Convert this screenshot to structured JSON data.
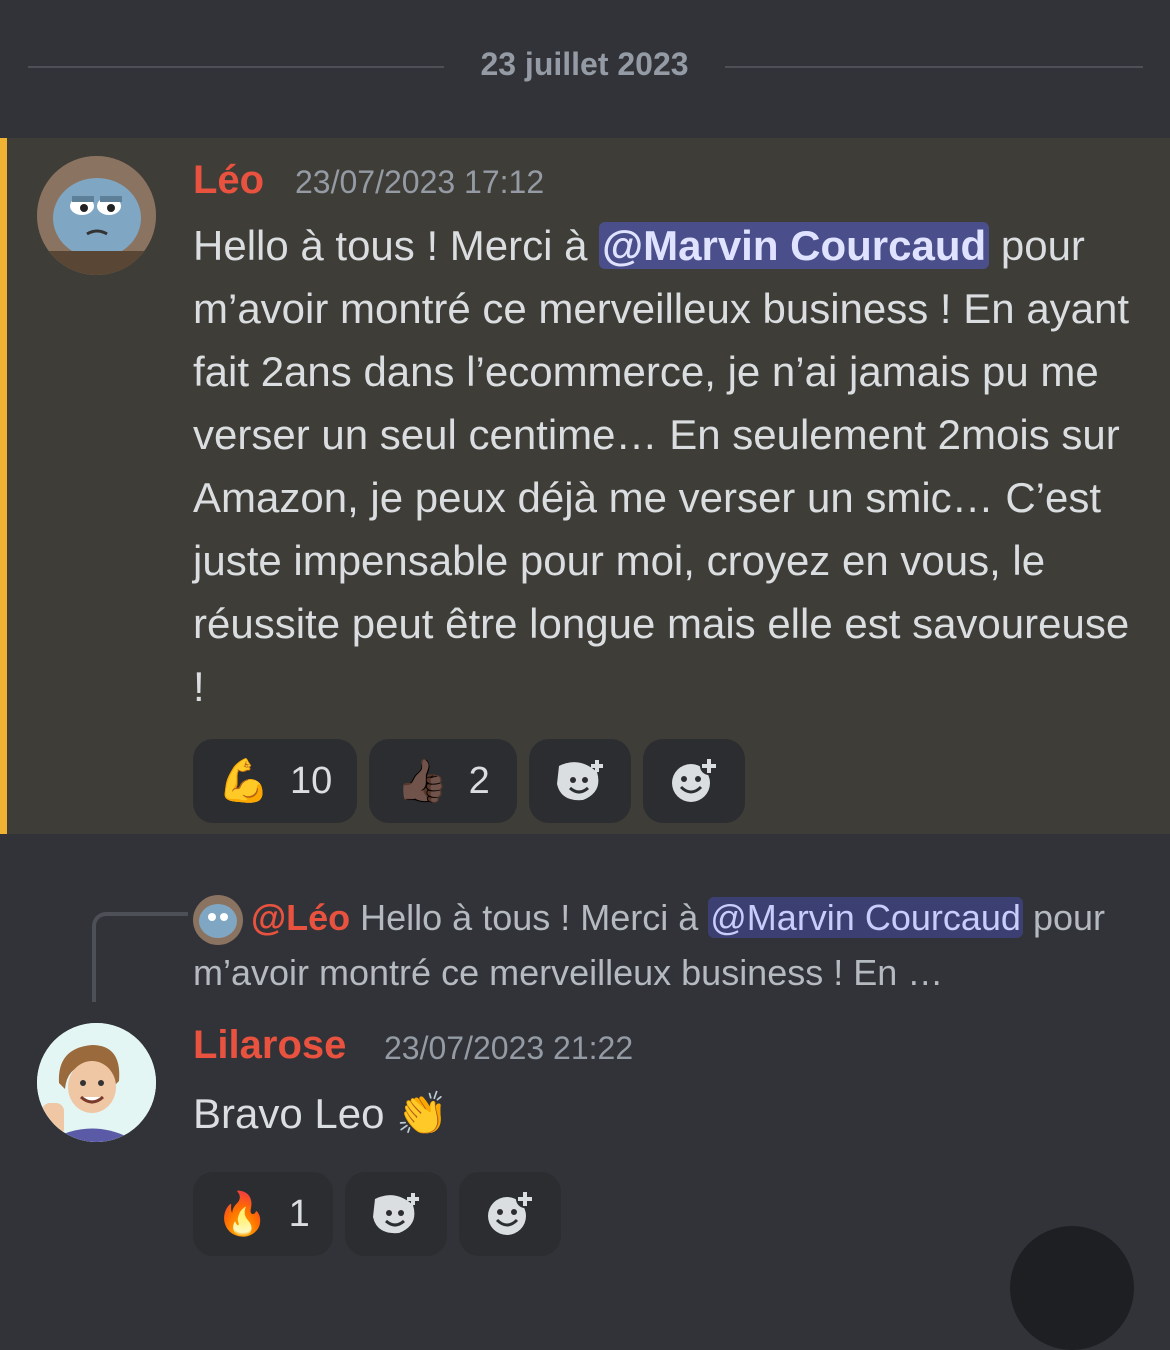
{
  "date_divider": "23 juillet 2023",
  "message1": {
    "author": "Léo",
    "timestamp": "23/07/2023 17:12",
    "text_before": "Hello à tous ! Merci à ",
    "mention": "@Marvin Courcaud",
    "text_after": " pour m’avoir montré ce merveilleux business ! En ayant fait 2ans dans l’ecommerce, je n’ai jamais pu me verser un seul centime… En seulement 2mois sur Amazon, je peux déjà me verser un smic… C’est juste impensable pour moi, croyez en vous, le réussite peut être longue mais elle est savoureuse !",
    "reactions": [
      {
        "emoji": "💪",
        "count": "10"
      },
      {
        "emoji": "👍🏿",
        "count": "2"
      }
    ],
    "accent_color": "#f0b232"
  },
  "reply": {
    "author": "@Léo",
    "text_before": "Hello à tous ! Merci à ",
    "mention": "@Marvin Courcaud",
    "text_after": " pour m’avoir montré ce merveilleux business ! En …"
  },
  "message2": {
    "author": "Lilarose",
    "timestamp": "23/07/2023 21:22",
    "text": "Bravo Leo 👏",
    "reactions": [
      {
        "emoji": "🔥",
        "count": "1"
      }
    ]
  },
  "icons": {
    "add_super_reaction": "add-super-reaction-icon",
    "add_reaction": "add-reaction-icon"
  },
  "colors": {
    "background": "#313338",
    "highlight_background": "#3f3d37",
    "username": "#e8523f",
    "mention_bg": "#4a4e8a"
  }
}
